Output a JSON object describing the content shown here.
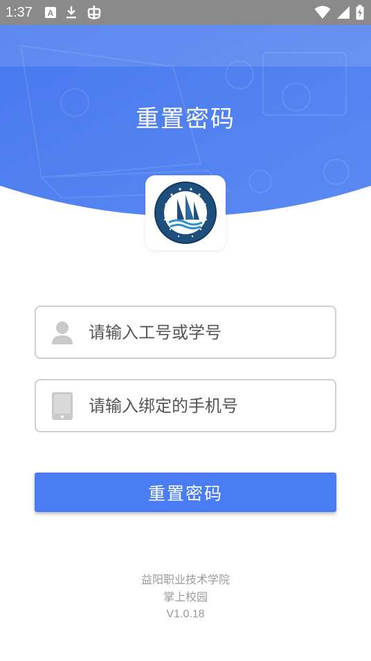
{
  "status_bar": {
    "time": "1:37",
    "icons": [
      "a-icon",
      "download-icon",
      "bug-icon",
      "wifi-icon",
      "signal-icon",
      "battery-charging-icon"
    ]
  },
  "hero": {
    "title": "重置密码"
  },
  "form": {
    "id_placeholder": "请输入工号或学号",
    "phone_placeholder": "请输入绑定的手机号",
    "submit_label": "重置密码"
  },
  "footer": {
    "school": "益阳职业技术学院",
    "app": "掌上校园",
    "version": "V1.0.18"
  },
  "colors": {
    "primary": "#4a7cf5",
    "hero": "#4f7ff1",
    "status_bar": "#8a8a8a"
  }
}
